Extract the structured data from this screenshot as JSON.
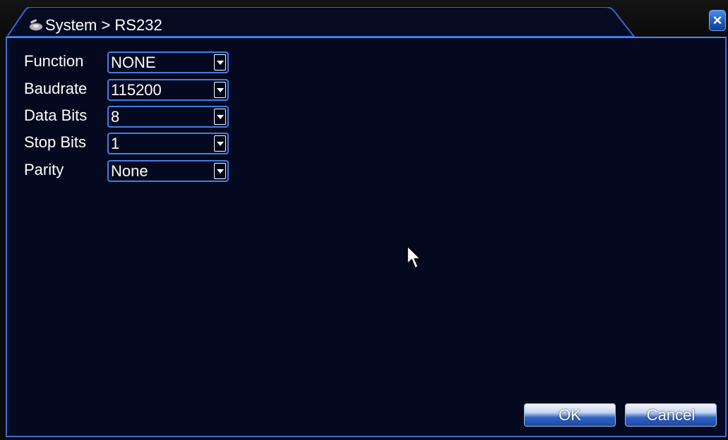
{
  "window": {
    "title": "System > RS232",
    "title_icon": "system-gear-icon",
    "close_label": "×"
  },
  "fields": [
    {
      "label": "Function",
      "value": "NONE"
    },
    {
      "label": "Baudrate",
      "value": "115200"
    },
    {
      "label": "Data Bits",
      "value": "8"
    },
    {
      "label": "Stop Bits",
      "value": "1"
    },
    {
      "label": "Parity",
      "value": "None"
    }
  ],
  "buttons": {
    "ok_label": "OK",
    "cancel_label": "Cancel"
  },
  "colors": {
    "background": "#04091f",
    "accent_border": "#3f7fe6",
    "text": "#ffffff"
  }
}
